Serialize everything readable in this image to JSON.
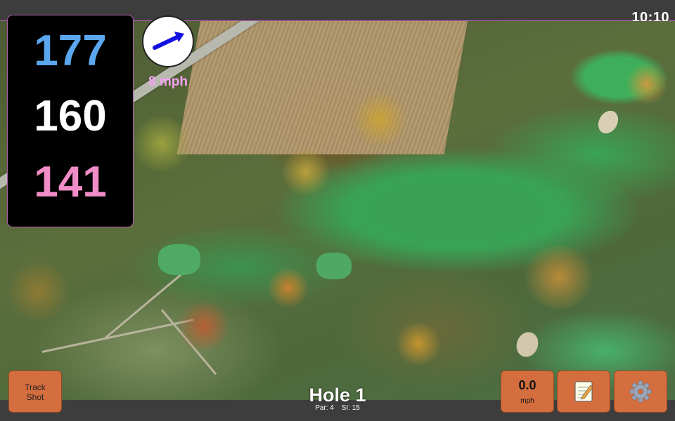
{
  "status_bar": {
    "time": "10:10"
  },
  "distances": {
    "back": "177",
    "middle": "160",
    "front": "141"
  },
  "wind": {
    "speed": "8 mph",
    "icon": "wind-direction-arrow-icon"
  },
  "buttons": {
    "track_shot_label": "Track\nShot",
    "speed_value": "0.0",
    "speed_unit": "mph",
    "notes_icon": "notepad-icon",
    "settings_icon": "gear-icon"
  },
  "hole": {
    "title": "Hole 1",
    "par": "Par: 4",
    "si": "SI: 15"
  },
  "colors": {
    "back_distance": "#5aa7ef",
    "middle_distance": "#ffffff",
    "front_distance": "#f08cc6",
    "button": "#d56e3e",
    "accent_border": "#b05fb0"
  }
}
